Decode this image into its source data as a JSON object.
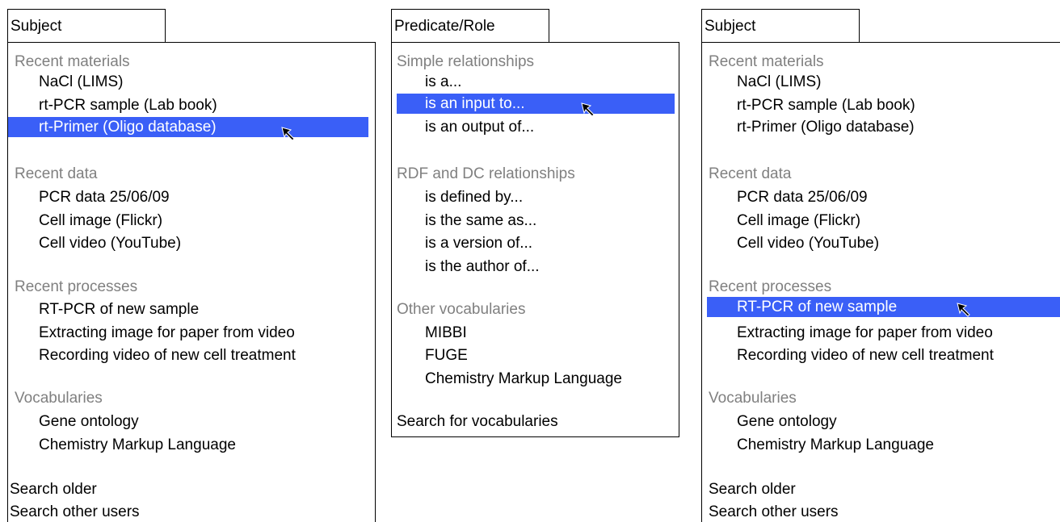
{
  "panels": [
    {
      "title": "Subject",
      "recent_materials": {
        "header": "Recent materials",
        "items": [
          "NaCl (LIMS)",
          "rt-PCR sample (Lab book)",
          "rt-Primer (Oligo database)"
        ],
        "selected": "rt-Primer (Oligo database)"
      },
      "recent_data": {
        "header": "Recent data",
        "items": [
          "PCR data 25/06/09",
          "Cell image (Flickr)",
          "Cell video (YouTube)"
        ]
      },
      "recent_processes": {
        "header": "Recent processes",
        "items": [
          "RT-PCR of new sample",
          "Extracting image for paper from video",
          "Recording video of new cell treatment"
        ]
      },
      "vocabularies": {
        "header": "Vocabularies",
        "items": [
          "Gene ontology",
          "Chemistry Markup Language"
        ]
      },
      "actions": [
        "Search older",
        "Search other users"
      ]
    },
    {
      "title": "Predicate/Role",
      "simple": {
        "header": "Simple relationships",
        "items": [
          "is a...",
          "is an input to...",
          "is an output of..."
        ],
        "selected": "is an input to..."
      },
      "rdf_dc": {
        "header": "RDF and DC relationships",
        "items": [
          "is defined by...",
          "is the same as...",
          "is a version of...",
          "is the author of..."
        ]
      },
      "other": {
        "header": "Other vocabularies",
        "items": [
          "MIBBI",
          "FUGE",
          "Chemistry Markup Language"
        ]
      },
      "actions": [
        "Search for vocabularies"
      ]
    },
    {
      "title": "Subject",
      "recent_materials": {
        "header": "Recent materials",
        "items": [
          "NaCl (LIMS)",
          "rt-PCR sample (Lab book)",
          "rt-Primer (Oligo database)"
        ]
      },
      "recent_data": {
        "header": "Recent data",
        "items": [
          "PCR data 25/06/09",
          "Cell image (Flickr)",
          "Cell video (YouTube)"
        ]
      },
      "recent_processes": {
        "header": "Recent processes",
        "items": [
          "RT-PCR of new sample",
          "Extracting image for paper from video",
          "Recording video of new cell treatment"
        ],
        "selected": "RT-PCR of new sample"
      },
      "vocabularies": {
        "header": "Vocabularies",
        "items": [
          "Gene ontology",
          "Chemistry Markup Language"
        ]
      },
      "actions": [
        "Search older",
        "Search other users"
      ]
    }
  ],
  "colors": {
    "selection": "#3a5ff7",
    "header_text": "#808080",
    "border": "#000000"
  },
  "icons": {
    "pointer": "mouse-pointer-icon"
  }
}
